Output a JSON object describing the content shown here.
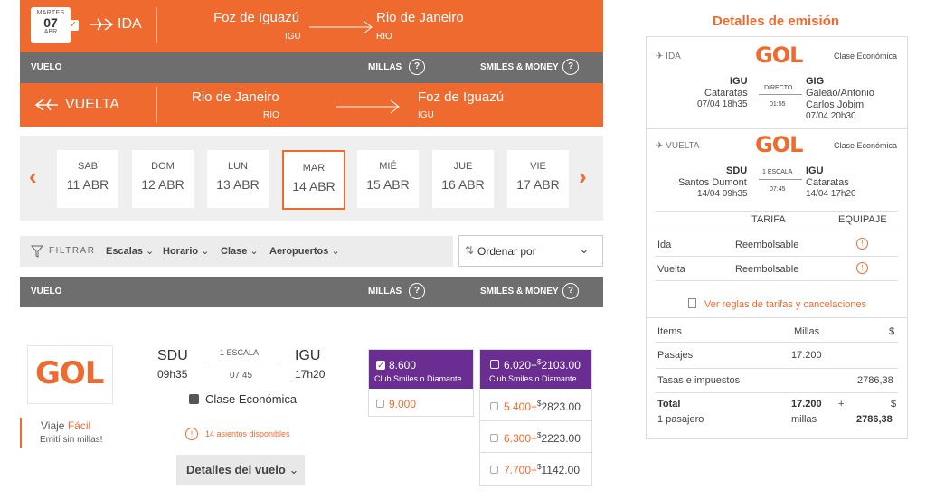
{
  "ida": {
    "weekday": "MARTES",
    "day": "07",
    "month": "ABR",
    "label": "IDA",
    "origin_city": "Foz de Iguazú",
    "origin_code": "IGU",
    "dest_city": "Rio de Janeiro",
    "dest_code": "RIO"
  },
  "header_bar": {
    "vuelo": "VUELO",
    "millas": "MILLAS",
    "smiles_money": "SMILES & MONEY",
    "help": "?"
  },
  "vuelta": {
    "label": "VUELTA",
    "origin_city": "Rio de Janeiro",
    "origin_code": "RIO",
    "dest_city": "Foz de Iguazú",
    "dest_code": "IGU"
  },
  "dates": [
    {
      "wd": "SAB",
      "dd": "11 ABR"
    },
    {
      "wd": "DOM",
      "dd": "12 ABR"
    },
    {
      "wd": "LUN",
      "dd": "13 ABR"
    },
    {
      "wd": "MAR",
      "dd": "14 ABR"
    },
    {
      "wd": "MIÉ",
      "dd": "15 ABR"
    },
    {
      "wd": "JUE",
      "dd": "16 ABR"
    },
    {
      "wd": "VIE",
      "dd": "17 ABR"
    }
  ],
  "filter": {
    "label": "FILTRAR",
    "items": [
      "Escalas",
      "Horario",
      "Clase",
      "Aeropuertos"
    ],
    "sort": "Ordenar por"
  },
  "flight": {
    "airline": "GOL",
    "from_code": "SDU",
    "from_time": "09h35",
    "stops": "1 ESCALA",
    "duration": "07:45",
    "to_code": "IGU",
    "to_time": "17h20",
    "class": "Clase Económica",
    "seats": "14 asientos disponibles",
    "details": "Detalles del vuelo",
    "viaje": "Viaje",
    "facil": "Fácil",
    "emiti": "Emití sin millas!"
  },
  "fares_millas": {
    "selected": {
      "amount": "8.600",
      "club": "Club Smiles o Diamante"
    },
    "other": "9.000"
  },
  "fares_money": {
    "selected": {
      "miles": "6.020+",
      "cur": "$",
      "money": "2103.00",
      "club": "Club Smiles o Diamante"
    },
    "rows": [
      {
        "miles": "5.400+",
        "cur": "$",
        "money": "2823.00"
      },
      {
        "miles": "6.300+",
        "cur": "$",
        "money": "2223.00"
      },
      {
        "miles": "7.700+",
        "cur": "$",
        "money": "1142.00"
      }
    ]
  },
  "summary": {
    "title": "Detalles de emisión",
    "ida": {
      "label": "IDA",
      "airline": "GOL",
      "cabin": "Clase Económica",
      "from_code": "IGU",
      "from_name": "Cataratas",
      "from_dt": "07/04 18h35",
      "stops": "DIRECTO",
      "duration": "01:55",
      "to_code": "GIG",
      "to_name": "Galeão/Antonio",
      "to_name2": "Carlos Jobim",
      "to_dt": "07/04 20h30"
    },
    "vuelta": {
      "label": "VUELTA",
      "airline": "GOL",
      "cabin": "Clase Económica",
      "from_code": "SDU",
      "from_name": "Santos Dumont",
      "from_dt": "14/04 09h35",
      "stops": "1 ESCALA",
      "duration": "07:45",
      "to_code": "IGU",
      "to_name": "Cataratas",
      "to_dt": "14/04 17h20"
    },
    "tarifa_header": "TARIFA",
    "equipaje_header": "EQUIPAJE",
    "tarifa_rows": [
      {
        "label": "Ida",
        "value": "Reembolsable"
      },
      {
        "label": "Vuelta",
        "value": "Reembolsable"
      }
    ],
    "rules_link": "Ver reglas de tarifas y cancelaciones",
    "items_header": "Items",
    "millas_header": "Millas",
    "dollar_header": "$",
    "pasajes": {
      "label": "Pasajes",
      "millas": "17.200"
    },
    "tasas": {
      "label": "Tasas e impuestos",
      "amount": "2786,38"
    },
    "total": {
      "label": "Total",
      "sub": "1 pasajero",
      "millas": "17.200",
      "plus": "+",
      "millas_unit": "millas",
      "cur": "$",
      "amount": "2786,38"
    }
  },
  "colors": {
    "brand_orange": "#ee6a2f",
    "club_purple": "#6a2d91",
    "bar_gray": "#6e6e6e"
  }
}
